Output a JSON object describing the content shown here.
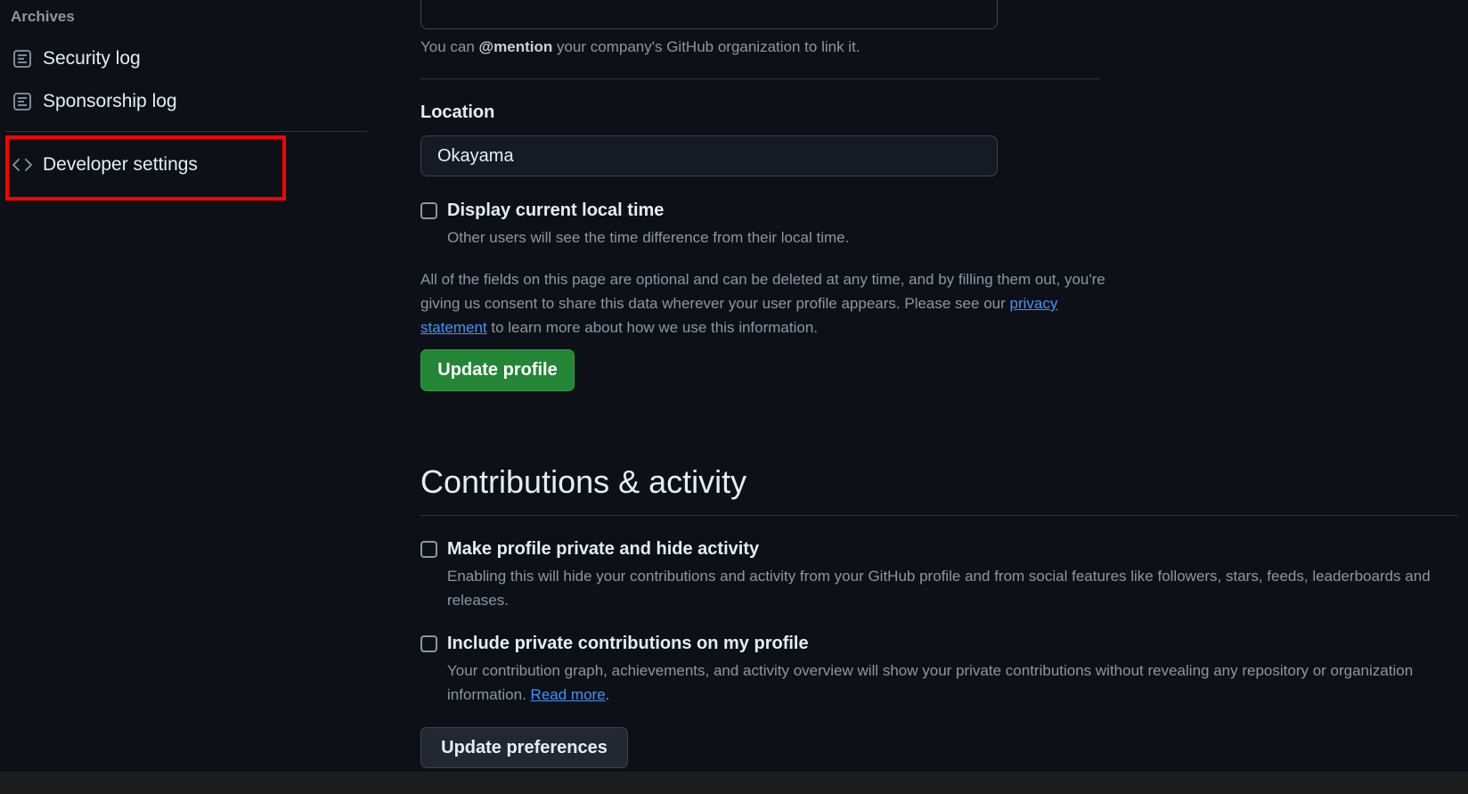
{
  "sidebar": {
    "heading": "Archives",
    "items": [
      {
        "label": "Security log",
        "icon": "log-icon"
      },
      {
        "label": "Sponsorship log",
        "icon": "log-icon"
      },
      {
        "label": "Developer settings",
        "icon": "code-icon"
      }
    ]
  },
  "company": {
    "hint_prefix": "You can ",
    "hint_mention": "@mention",
    "hint_suffix": " your company's GitHub organization to link it."
  },
  "location": {
    "label": "Location",
    "value": "Okayama"
  },
  "local_time": {
    "title": "Display current local time",
    "description": "Other users will see the time difference from their local time."
  },
  "consent": {
    "text_before": "All of the fields on this page are optional and can be deleted at any time, and by filling them out, you're giving us consent to share this data wherever your user profile appears. Please see our ",
    "link": "privacy statement",
    "text_after": " to learn more about how we use this information."
  },
  "update_profile_label": "Update profile",
  "contributions": {
    "title": "Contributions & activity",
    "private_profile": {
      "title": "Make profile private and hide activity",
      "description": "Enabling this will hide your contributions and activity from your GitHub profile and from social features like followers, stars, feeds, leaderboards and releases."
    },
    "private_contribs": {
      "title": "Include private contributions on my profile",
      "description_before": "Your contribution graph, achievements, and activity overview will show your private contributions without revealing any repository or organization information. ",
      "link": "Read more",
      "description_after": "."
    },
    "update_label": "Update preferences"
  },
  "colors": {
    "background": "#0d1117",
    "accent_green": "#238636",
    "link": "#4493f8",
    "highlight": "#ff0000"
  }
}
